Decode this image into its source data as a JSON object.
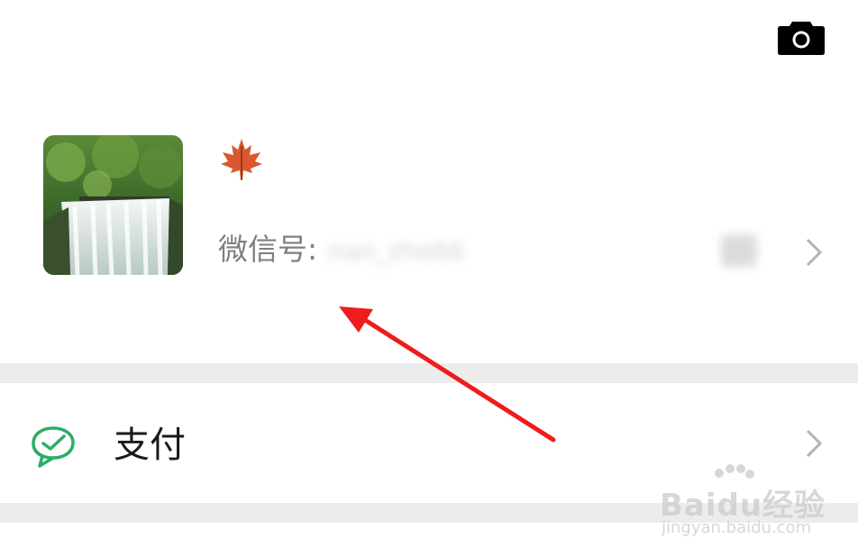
{
  "header": {
    "camera_icon": "camera-icon"
  },
  "profile": {
    "avatar_description": "waterfall",
    "nickname_icon": "maple-leaf-icon",
    "wechat_id_label": "微信号:",
    "wechat_id_value": "nan_zhe66",
    "qr_icon": "qr-code-icon",
    "chevron_icon": "chevron-right-icon"
  },
  "menu": {
    "pay": {
      "label": "支付",
      "icon": "wechat-pay-icon",
      "icon_color": "#2aae67"
    }
  },
  "annotation": {
    "arrow_color": "#ee1c1c"
  },
  "watermark": {
    "main": "Baidu经验",
    "sub": "jingyan.baidu.com"
  }
}
